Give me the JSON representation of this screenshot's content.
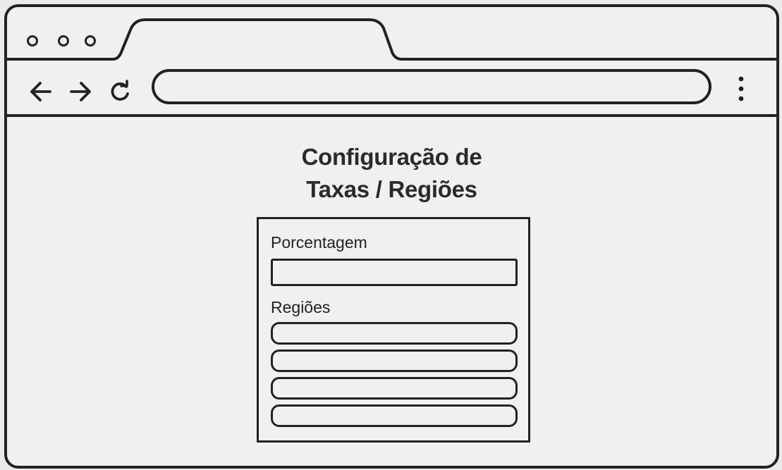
{
  "browser": {
    "window_controls": [
      "window-dot-1",
      "window-dot-2",
      "window-dot-3"
    ],
    "tab": {
      "title": ""
    },
    "nav": {
      "back_icon": "arrow-left-icon",
      "forward_icon": "arrow-right-icon",
      "reload_icon": "reload-icon"
    },
    "address_bar": {
      "value": "",
      "placeholder": ""
    },
    "menu_icon": "vertical-dots-icon"
  },
  "page": {
    "title_line1": "Configuração de",
    "title_line2": "Taxas / Regiões"
  },
  "form": {
    "percentage": {
      "label": "Porcentagem",
      "value": ""
    },
    "regions": {
      "label": "Regiões",
      "items": [
        "",
        "",
        "",
        ""
      ]
    }
  },
  "colors": {
    "stroke": "#222222",
    "background": "#f0f0ef"
  }
}
